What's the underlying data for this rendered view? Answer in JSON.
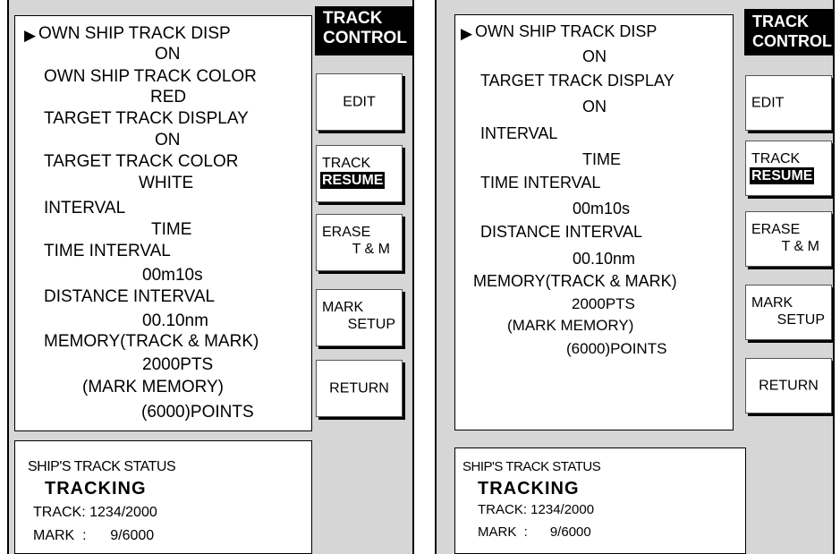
{
  "screens": [
    {
      "menu": [
        "OWN SHIP TRACK DISP",
        "ON",
        "OWN SHIP TRACK COLOR",
        "RED",
        "TARGET TRACK DISPLAY",
        "ON",
        "TARGET TRACK COLOR",
        "WHITE",
        "INTERVAL",
        "TIME",
        "TIME INTERVAL",
        "00m10s",
        "DISTANCE INTERVAL",
        "00.10nm",
        "MEMORY(TRACK & MARK)",
        "2000PTS",
        "(MARK MEMORY)",
        "(6000)POINTS"
      ],
      "title": [
        "TRACK",
        "CONTROL"
      ],
      "buttons": {
        "edit": "EDIT",
        "track_resume": [
          "TRACK",
          "RESUME"
        ],
        "erase": [
          "ERASE",
          "T & M"
        ],
        "mark_setup": [
          "MARK",
          "SETUP"
        ],
        "return": "RETURN"
      },
      "status": {
        "heading": "SHIP'S TRACK STATUS",
        "state": "TRACKING",
        "track": "TRACK: 1234/2000",
        "mark": "MARK  :      9/6000"
      }
    },
    {
      "menu": [
        "OWN SHIP TRACK DISP",
        "ON",
        "TARGET TRACK DISPLAY",
        "ON",
        "INTERVAL",
        "TIME",
        "TIME INTERVAL",
        "00m10s",
        "DISTANCE INTERVAL",
        "00.10nm",
        "MEMORY(TRACK & MARK)",
        "2000PTS",
        "(MARK MEMORY)",
        "(6000)POINTS"
      ],
      "title": [
        "TRACK",
        "CONTROL"
      ],
      "buttons": {
        "edit": "EDIT",
        "track_resume": [
          "TRACK",
          "RESUME"
        ],
        "erase": [
          "ERASE",
          "T & M"
        ],
        "mark_setup": [
          "MARK",
          "SETUP"
        ],
        "return": "RETURN"
      },
      "status": {
        "heading": "SHIP'S TRACK STATUS",
        "state": "TRACKING",
        "track": "TRACK: 1234/2000",
        "mark": "MARK  :      9/6000"
      }
    }
  ],
  "cursor_glyph": "▶"
}
